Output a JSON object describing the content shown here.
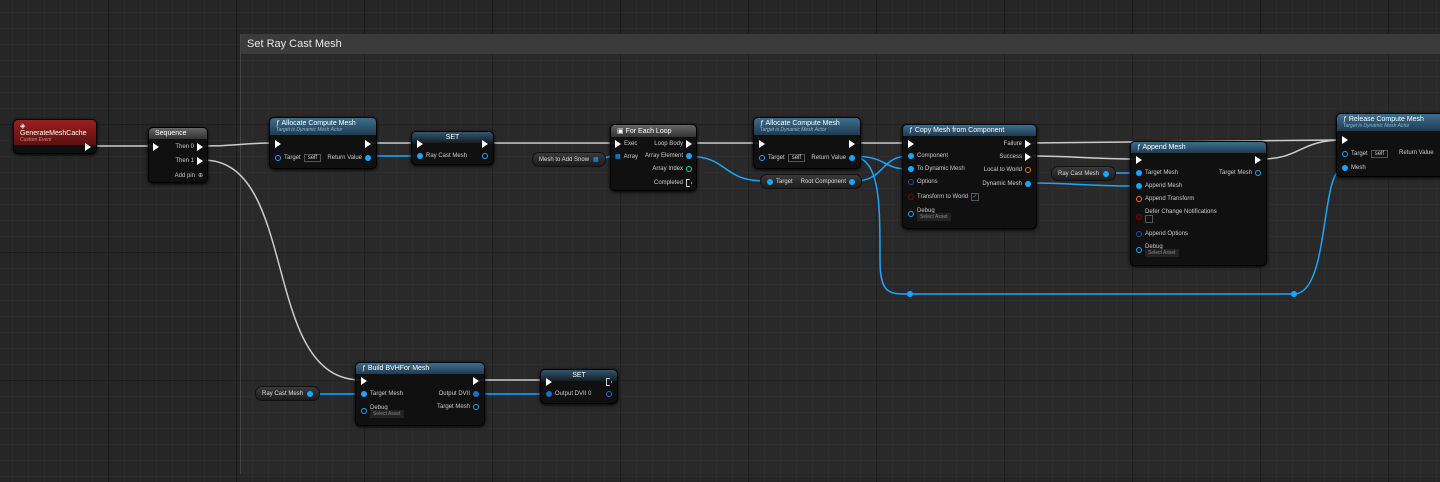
{
  "comment": {
    "title": "Set Ray Cast Mesh"
  },
  "nodes": {
    "event": {
      "title": "GenerateMeshCache",
      "subtitle": "Custom Event"
    },
    "sequence": {
      "title": "Sequence",
      "then0": "Then 0",
      "then1": "Then 1",
      "add_pin": "Add pin"
    },
    "alloc1": {
      "title": "Allocate Compute Mesh",
      "subtitle": "Target is Dynamic Mesh Actor",
      "target": "Target",
      "target_value": "self",
      "return": "Return Value"
    },
    "set1": {
      "title": "SET",
      "pin": "Ray Cast Mesh"
    },
    "mesh_to_add_snow": {
      "label": "Mesh to Add Snow"
    },
    "foreach": {
      "title": "For Each Loop",
      "exec": "Exec",
      "array": "Array",
      "loop_body": "Loop Body",
      "array_element": "Array Element",
      "array_index": "Array Index",
      "completed": "Completed"
    },
    "alloc2": {
      "title": "Allocate Compute Mesh",
      "subtitle": "Target is Dynamic Mesh Actor",
      "target": "Target",
      "target_value": "self",
      "return": "Return Value"
    },
    "root": {
      "target": "Target",
      "output": "Root Component"
    },
    "copy": {
      "title": "Copy Mesh from Component",
      "component": "Component",
      "to_dynamic": "To Dynamic Mesh",
      "options": "Options",
      "transform": "Transform to World",
      "transform_checked": true,
      "debug": "Debug",
      "select": "Select Asset",
      "failure": "Failure",
      "success": "Success",
      "local_to_world": "Local to World",
      "dynamic_mesh": "Dynamic Mesh"
    },
    "raycast_var1": {
      "label": "Ray Cast Mesh"
    },
    "append": {
      "title": "Append Mesh",
      "target_mesh": "Target Mesh",
      "append_mesh": "Append Mesh",
      "append_transform": "Append Transform",
      "defer": "Defer Change Notifications",
      "append_options": "Append Options",
      "debug": "Debug",
      "select": "Select Asset",
      "out_target": "Target Mesh"
    },
    "release": {
      "title": "Release Compute Mesh",
      "subtitle": "Target is Dynamic Mesh Actor",
      "target": "Target",
      "target_value": "self",
      "mesh": "Mesh",
      "return": "Return Value"
    },
    "raycast_var2": {
      "label": "Ray Cast Mesh"
    },
    "bvh": {
      "title": "Build BVHFor Mesh",
      "target_mesh": "Target Mesh",
      "debug": "Debug",
      "select": "Select Asset",
      "output": "Output DVII",
      "out_target": "Target Mesh"
    },
    "set2": {
      "title": "SET",
      "pin": "Output DVII 0"
    }
  },
  "colors": {
    "exec": "#ffffff",
    "object": "#1aa5ff",
    "function_header": "#3d6e90",
    "event_header": "#9b2020",
    "transform": "#e87a1a",
    "bool": "#8b0000",
    "struct": "#1a4fa0",
    "int": "#1fd6a0"
  }
}
